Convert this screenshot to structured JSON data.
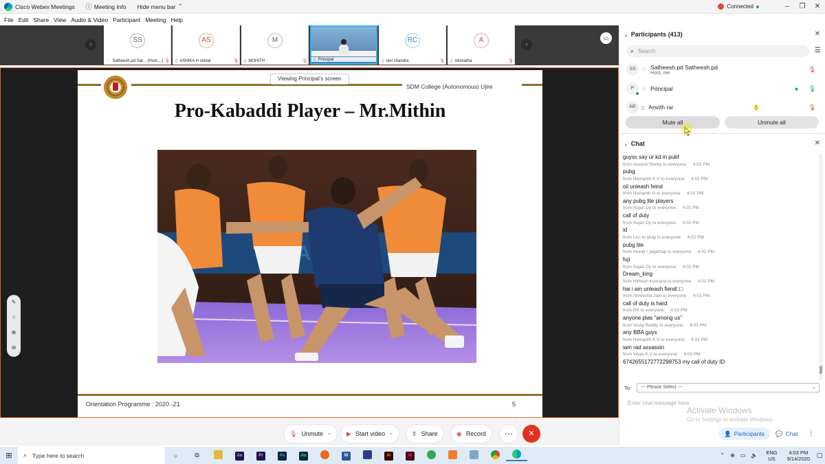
{
  "titlebar": {
    "app_title": "Cisco Webex Meetings",
    "meeting_info": "Meeting Info",
    "hide_menu": "Hide menu bar",
    "status": "Connected"
  },
  "menu": [
    "File",
    "Edit",
    "Share",
    "View",
    "Audio & Video",
    "Participant",
    "Meeting",
    "Help"
  ],
  "thumbnails": [
    {
      "initials": "SS",
      "name": "Satheesh.pd Sat... (Host,...)",
      "style": "plain"
    },
    {
      "initials": "AS",
      "name": "ASHIKA H shirial",
      "style": "red"
    },
    {
      "initials": "M",
      "name": "MOHITH",
      "style": "plain"
    },
    {
      "initials": "",
      "name": "Principal",
      "style": "video"
    },
    {
      "initials": "RC",
      "name": "ravi chandra",
      "style": "blue"
    },
    {
      "initials": "A",
      "name": "Akshatha",
      "style": "red"
    }
  ],
  "stage": {
    "viewing_label": "Viewing Principal's screen",
    "college": "SDM College (Autonomous) Ujire",
    "slide_title": "Pro-Kabaddi Player – Mr.Mithin",
    "footer": "Orientation Programme : 2020 -21",
    "page": "5"
  },
  "participants": {
    "header": "Participants (413)",
    "search_placeholder": "Search",
    "list": [
      {
        "initials": "SS",
        "name": "Satheesh.pd Satheesh.pd",
        "sub": "Host, me"
      },
      {
        "initials": "P",
        "name": "Principal",
        "sub": ""
      },
      {
        "initials": "AR",
        "name": "Anvith rai",
        "sub": ""
      }
    ],
    "mute_all": "Mute all",
    "unmute_all": "Unmute all"
  },
  "chat": {
    "header": "Chat",
    "messages": [
      {
        "text": "guyss say ur kd in pubf",
        "from": "from Anvesh Shetty to everyone:",
        "time": "4:02 PM"
      },
      {
        "text": "pubg",
        "from": "from Hemanth K.V to everyone:",
        "time": "4:02 PM"
      },
      {
        "text": "oii unleash feind",
        "from": "from Nishanth G to everyone:",
        "time": "4:02 PM"
      },
      {
        "text": "any pubg lite players",
        "from": "from Sujan Dy to everyone:",
        "time": "4:02 PM"
      },
      {
        "text": "call of duty",
        "from": "from Sujan Dy to everyone:",
        "time": "4:02 PM"
      },
      {
        "text": "id",
        "from": "from Leo m shaji to everyone:",
        "time": "4:02 PM"
      },
      {
        "text": "pubg lite",
        "from": "from murali r jagathap to everyone:",
        "time": "4:02 PM"
      },
      {
        "text": "fuji",
        "from": "from Sujan Dy to everyone:",
        "time": "4:02 PM"
      },
      {
        "text": "Dream_king",
        "from": "from Hithesh Koorana to everyone:",
        "time": "4:02 PM"
      },
      {
        "text": "hai i am unleash fiend□□",
        "from": "from Shreesha Jain to everyone:",
        "time": "4:03 PM"
      },
      {
        "text": "call of duty is hard",
        "from": "from RK to everyone:",
        "time": "4:03 PM"
      },
      {
        "text": "anyone plas \"among us\"",
        "from": "from Vinay Reddy to everyone:",
        "time": "4:03 PM"
      },
      {
        "text": "any BBA guys",
        "from": "from Hemanth K.V to everyone:",
        "time": "4:03 PM"
      },
      {
        "text": "iam rad assassin",
        "from": "from Vikas K.V to everyone:",
        "time": "4:03 PM"
      },
      {
        "text": "6742655172772298753 my call of duty ID",
        "from": "",
        "time": ""
      }
    ],
    "to_label": "To:",
    "to_value": "--- Please Select ---",
    "input_placeholder": "Enter chat message here"
  },
  "watermark": {
    "line1": "Activate Windows",
    "line2": "Go to Settings to activate Windows."
  },
  "panel_tabs": {
    "participants": "Participants",
    "chat": "Chat"
  },
  "controls": {
    "unmute": "Unmute",
    "start_video": "Start video",
    "share": "Share",
    "record": "Record"
  },
  "taskbar": {
    "search_placeholder": "Type here to search",
    "lang_top": "ENG",
    "lang_bottom": "US",
    "time": "4:03 PM",
    "date": "9/14/2020"
  },
  "colors": {
    "accent": "#1a5fb4",
    "danger": "#e1321f",
    "stage_border": "#e26b2a",
    "gold": "#8a7328"
  }
}
